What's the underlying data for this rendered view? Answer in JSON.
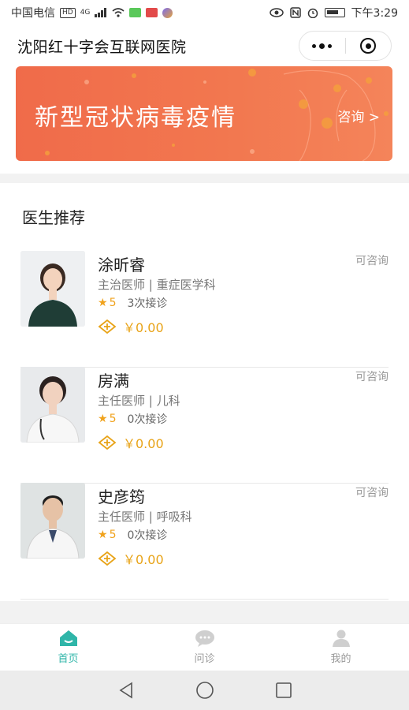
{
  "status_bar": {
    "carrier": "中国电信",
    "hd": "HD",
    "network": "4G",
    "time": "下午3:29"
  },
  "header": {
    "title": "沈阳红十字会互联网医院"
  },
  "banner": {
    "title": "新型冠状病毒疫情",
    "link": "咨询 >",
    "color": "#f06b4a"
  },
  "section": {
    "title": "医生推荐"
  },
  "doctors": [
    {
      "name": "涂昕睿",
      "title": "主治医师 | 重症医学科",
      "rating": "5",
      "visits": "3次接诊",
      "price": "￥0.00",
      "consult": "可咨询"
    },
    {
      "name": "房满",
      "title": "主任医师 | 儿科",
      "rating": "5",
      "visits": "0次接诊",
      "price": "￥0.00",
      "consult": "可咨询"
    },
    {
      "name": "史彦筠",
      "title": "主任医师 | 呼吸科",
      "rating": "5",
      "visits": "0次接诊",
      "price": "￥0.00",
      "consult": "可咨询"
    }
  ],
  "tabs": [
    {
      "label": "首页",
      "icon": "home-icon",
      "active": true
    },
    {
      "label": "问诊",
      "icon": "chat-icon",
      "active": false
    },
    {
      "label": "我的",
      "icon": "user-icon",
      "active": false
    }
  ],
  "colors": {
    "accent": "#2fb5a8",
    "price": "#e8a317",
    "star": "#f0a21c"
  }
}
